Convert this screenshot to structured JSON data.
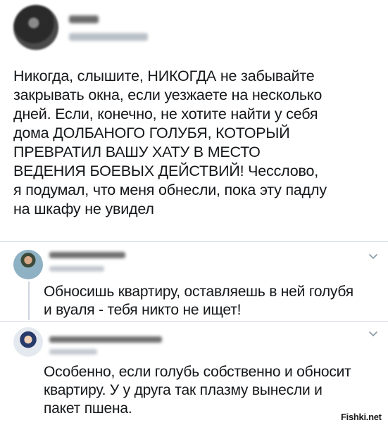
{
  "tweet": {
    "text": "Никогда, слышите, НИКОГДА не забывайте\nзакрывать окна, если уезжаете на несколько\nдней. Если, конечно, не хотите найти у себя\nдома ДОЛБАНОГО ГОЛУБЯ, КОТОРЫЙ\nПРЕВРАТИЛ ВАШУ ХАТУ В МЕСТО\nВЕДЕНИЯ БОЕВЫХ ДЕЙСТВИЙ! Чесслово,\nя подумал, что меня обнесли, пока эту падлу\nна шкафу не увидел"
  },
  "replies": [
    {
      "text": "Обносишь квартиру, оставляешь в ней голубя\nи вуаля - тебя никто не ищет!"
    },
    {
      "text": "Особенно, если голубь собственно и обносит\nквартиру. У у друга так плазму вынесли и\nпакет пшена."
    }
  ],
  "watermark": "Fishki.net",
  "colors": {
    "text": "#14171a",
    "divider": "#d4dbe1",
    "muted": "#8899a6"
  },
  "icons": {
    "reply_menu": "chevron-down-icon"
  }
}
